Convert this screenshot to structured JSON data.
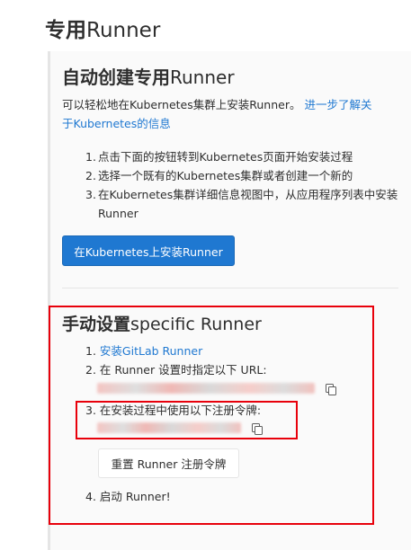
{
  "page": {
    "title_prefix": "专用",
    "title_latin": "Runner"
  },
  "auto": {
    "title_prefix": "自动创建专用",
    "title_latin": "Runner",
    "desc": "可以轻松地在Kubernetes集群上安装Runner。",
    "learn_more_1": "进一步了解关",
    "learn_more_2": "于Kubernetes的信息",
    "steps": [
      {
        "num": "1.",
        "text": "点击下面的按钮转到Kubernetes页面开始安装过程"
      },
      {
        "num": "2.",
        "text": "选择一个既有的Kubernetes集群或者创建一个新的"
      },
      {
        "num": "3.",
        "text": "在Kubernetes集群详细信息视图中，从应用程序列表中安装Runner"
      }
    ],
    "install_button": "在Kubernetes上安装Runner"
  },
  "manual": {
    "title_prefix": "手动设置",
    "title_latin": "specific Runner",
    "step1_num": "1.",
    "step1_link": "安装GitLab Runner",
    "step2": "2. 在 Runner 设置时指定以下 URL:",
    "step3": "3. 在安装过程中使用以下注册令牌:",
    "reset_button": "重置 Runner 注册令牌",
    "step4": "4. 启动 Runner!"
  },
  "icons": {
    "copy_url": "copy-icon",
    "copy_token": "copy-icon"
  },
  "colors": {
    "link": "#1f78d1",
    "primary_button": "#1f78d1",
    "annotation_red": "#e8000b"
  }
}
